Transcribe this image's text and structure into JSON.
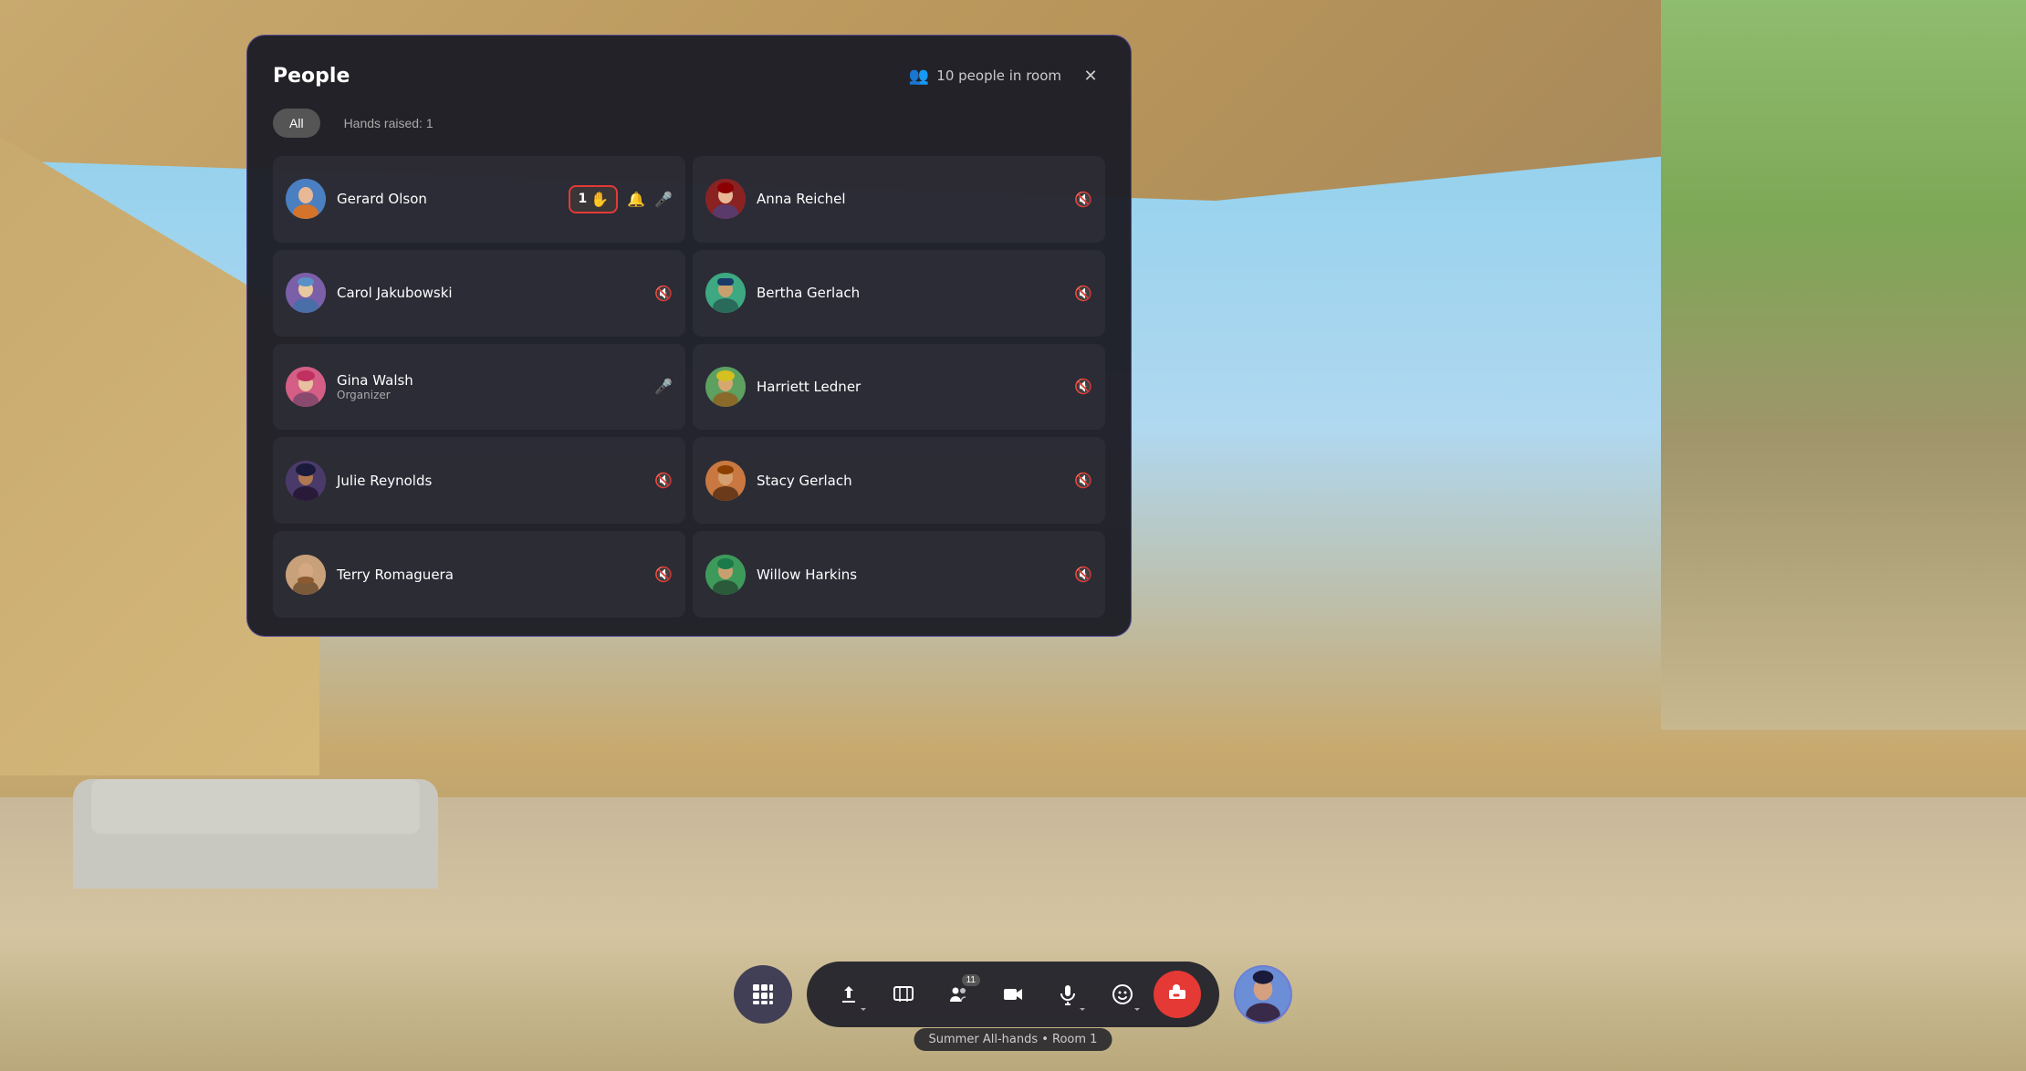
{
  "background": {
    "description": "Virtual meeting room background"
  },
  "panel": {
    "title": "People",
    "people_count_label": "10 people in room",
    "close_icon": "✕",
    "tabs": [
      {
        "id": "all",
        "label": "All",
        "active": true
      },
      {
        "id": "hands",
        "label": "Hands raised: 1",
        "active": false
      }
    ],
    "people": [
      {
        "id": "gerard",
        "name": "Gerard Olson",
        "role": "",
        "avatar_emoji": "🧑",
        "avatar_class": "av-blue",
        "has_hand_raised": true,
        "hand_count": 1,
        "mic_muted": false,
        "has_bell": true,
        "column": "left"
      },
      {
        "id": "anna",
        "name": "Anna Reichel",
        "role": "",
        "avatar_emoji": "👩",
        "avatar_class": "av-darkred",
        "has_hand_raised": false,
        "mic_muted": true,
        "column": "right"
      },
      {
        "id": "carol",
        "name": "Carol Jakubowski",
        "role": "",
        "avatar_emoji": "👩",
        "avatar_class": "av-purple",
        "has_hand_raised": false,
        "mic_muted": true,
        "column": "left"
      },
      {
        "id": "bertha",
        "name": "Bertha Gerlach",
        "role": "",
        "avatar_emoji": "👩",
        "avatar_class": "av-teal",
        "has_hand_raised": false,
        "mic_muted": true,
        "column": "right"
      },
      {
        "id": "gina",
        "name": "Gina Walsh",
        "role": "Organizer",
        "avatar_emoji": "👩",
        "avatar_class": "av-pink",
        "has_hand_raised": false,
        "mic_muted": false,
        "column": "left"
      },
      {
        "id": "harriett",
        "name": "Harriett Ledner",
        "role": "",
        "avatar_emoji": "👩",
        "avatar_class": "av-green",
        "has_hand_raised": false,
        "mic_muted": true,
        "column": "right"
      },
      {
        "id": "julie",
        "name": "Julie Reynolds",
        "role": "",
        "avatar_emoji": "👩",
        "avatar_class": "av-dark",
        "has_hand_raised": false,
        "mic_muted": true,
        "column": "left"
      },
      {
        "id": "stacy",
        "name": "Stacy Gerlach",
        "role": "",
        "avatar_emoji": "👩",
        "avatar_class": "av-orange",
        "has_hand_raised": false,
        "mic_muted": true,
        "column": "right"
      },
      {
        "id": "terry",
        "name": "Terry Romaguera",
        "role": "",
        "avatar_emoji": "🧔",
        "avatar_class": "av-sand",
        "has_hand_raised": false,
        "mic_muted": true,
        "column": "left"
      },
      {
        "id": "willow",
        "name": "Willow Harkins",
        "role": "",
        "avatar_emoji": "👩",
        "avatar_class": "av-green",
        "has_hand_raised": false,
        "mic_muted": true,
        "column": "right"
      }
    ]
  },
  "toolbar": {
    "grid_icon": "⋮⋮⋮",
    "share_icon": "↑",
    "video_icon": "🎬",
    "people_count": "11",
    "camera_icon": "📷",
    "mic_icon": "🎤",
    "emoji_icon": "😊",
    "end_icon": "📵",
    "user_avatar_emoji": "👩"
  },
  "room_label": "Summer All-hands • Room 1"
}
